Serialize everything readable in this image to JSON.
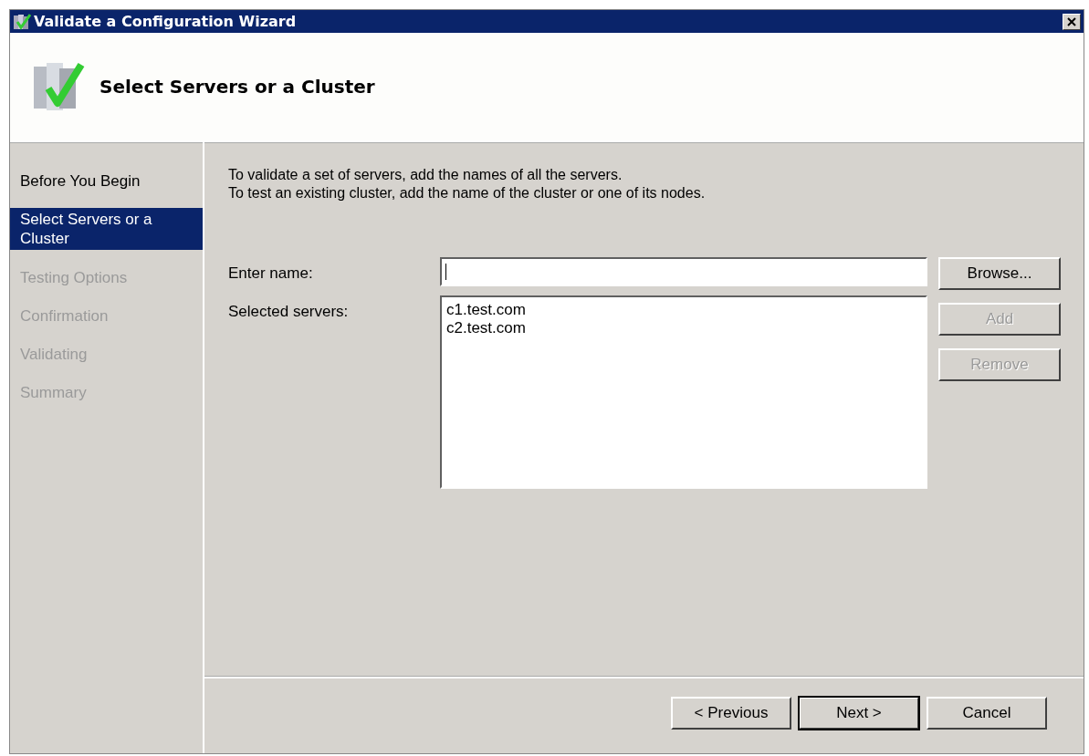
{
  "window": {
    "title": "Validate a Configuration Wizard"
  },
  "header": {
    "title": "Select Servers or a Cluster"
  },
  "steps": [
    {
      "label": "Before You Begin",
      "selected": false,
      "disabled": false
    },
    {
      "label": "Select Servers or a Cluster",
      "selected": true,
      "disabled": false
    },
    {
      "label": "Testing Options",
      "selected": false,
      "disabled": true
    },
    {
      "label": "Confirmation",
      "selected": false,
      "disabled": true
    },
    {
      "label": "Validating",
      "selected": false,
      "disabled": true
    },
    {
      "label": "Summary",
      "selected": false,
      "disabled": true
    }
  ],
  "instructions": [
    "To validate a set of servers, add the names of all the servers.",
    "To test an existing cluster, add the name of the cluster or one of its nodes."
  ],
  "enter_name": {
    "label": "Enter name:"
  },
  "selected_servers": {
    "label": "Selected servers:",
    "items": [
      "c1.test.com",
      "c2.test.com"
    ]
  },
  "side_buttons": [
    {
      "label": "Browse...",
      "disabled": false
    },
    {
      "label": "Add",
      "disabled": true
    },
    {
      "label": "Remove",
      "disabled": true
    }
  ],
  "footer_buttons": [
    {
      "label": "< Previous",
      "default": false
    },
    {
      "label": "Next >",
      "default": true
    },
    {
      "label": "Cancel",
      "default": false
    }
  ]
}
